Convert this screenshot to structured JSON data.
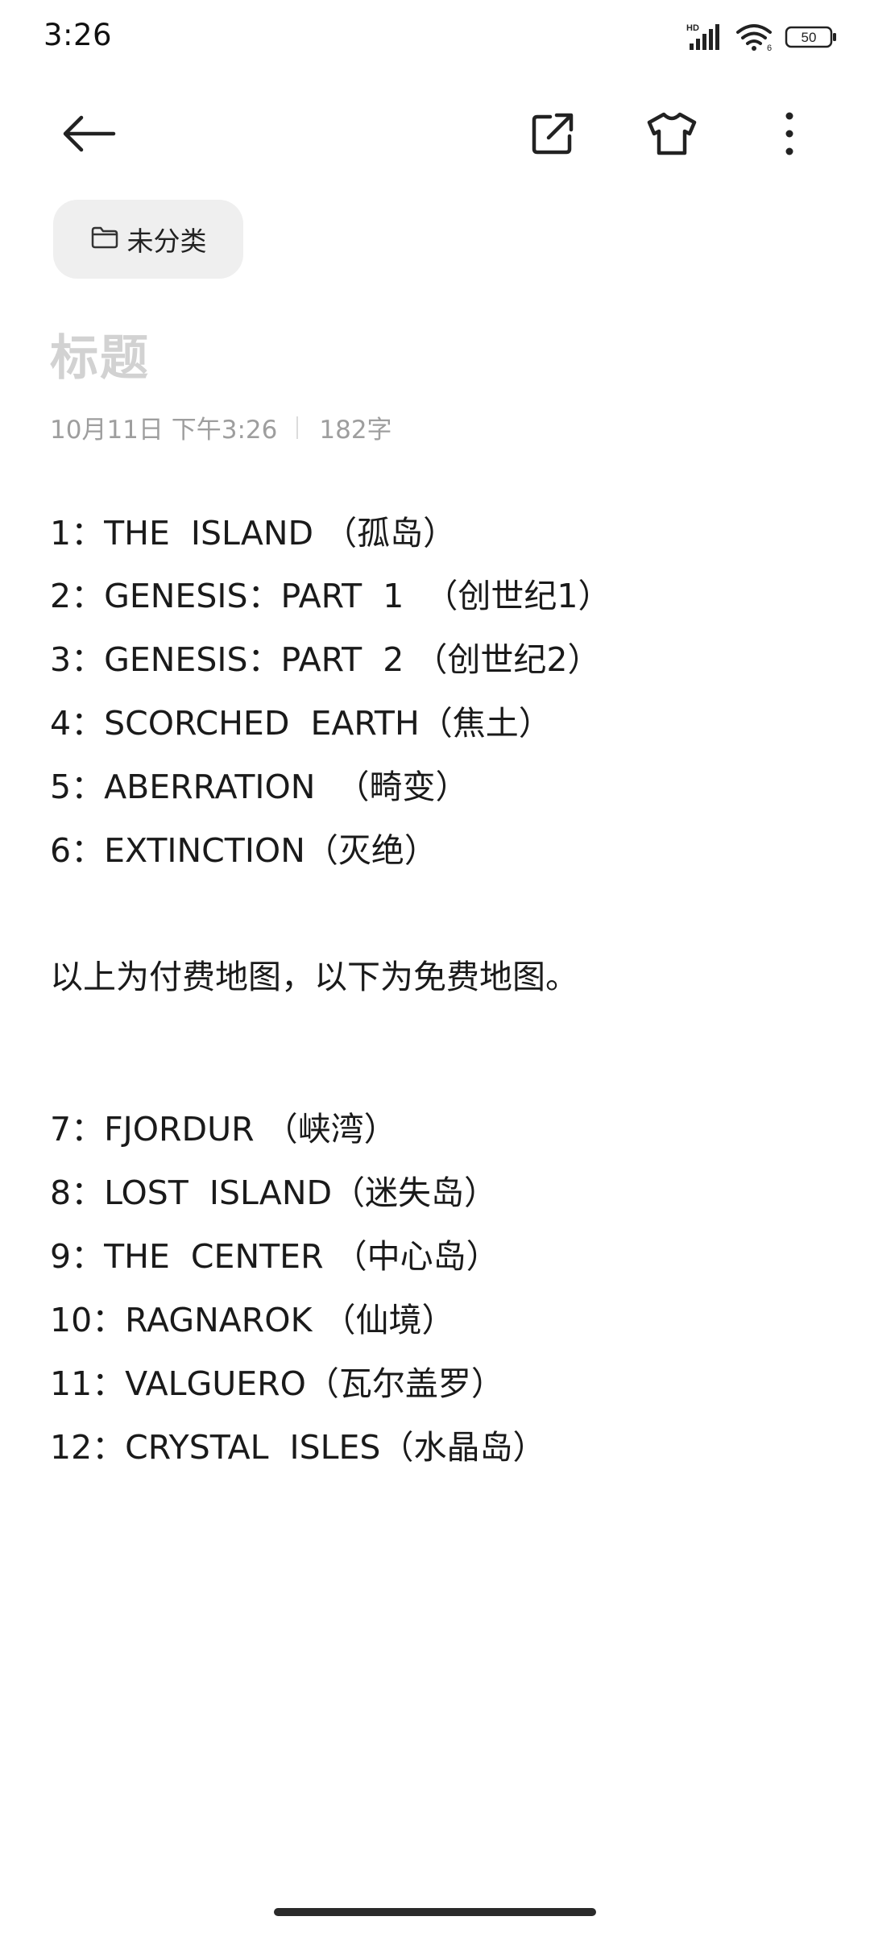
{
  "status_bar": {
    "time": "3:26",
    "hd_label": "HD",
    "wifi_badge": "6",
    "battery": "50",
    "icons": [
      "hd-signal-icon",
      "wifi-icon",
      "battery-icon"
    ]
  },
  "toolbar": {
    "back_icon": "back-arrow-icon",
    "share_icon": "share-external-icon",
    "theme_icon": "tshirt-theme-icon",
    "more_icon": "more-vertical-icon"
  },
  "category": {
    "icon": "folder-icon",
    "label": "未分类"
  },
  "note": {
    "title_placeholder": "标题",
    "date": "10月11日 下午3:26",
    "char_count": "182字",
    "lines": [
      "1：THE  ISLAND （孤岛）",
      "2：GENESIS：PART  1  （创世纪1）",
      "3：GENESIS：PART  2 （创世纪2）",
      "4：SCORCHED  EARTH（焦土）",
      "5：ABERRATION  （畸变）",
      "6：EXTINCTION（灭绝）",
      "以上为付费地图，以下为免费地图。",
      "7：FJORDUR （峡湾）",
      "8：LOST  ISLAND（迷失岛）",
      "9：THE  CENTER （中心岛）",
      "10：RAGNAROK （仙境）",
      "11：VALGUERO（瓦尔盖罗）",
      "12：CRYSTAL  ISLES（水晶岛）"
    ]
  },
  "colors": {
    "background": "#ffffff",
    "text": "#1a1a1a",
    "placeholder": "#d2d2d2",
    "meta": "#9e9e9e",
    "chip": "#efefef"
  }
}
